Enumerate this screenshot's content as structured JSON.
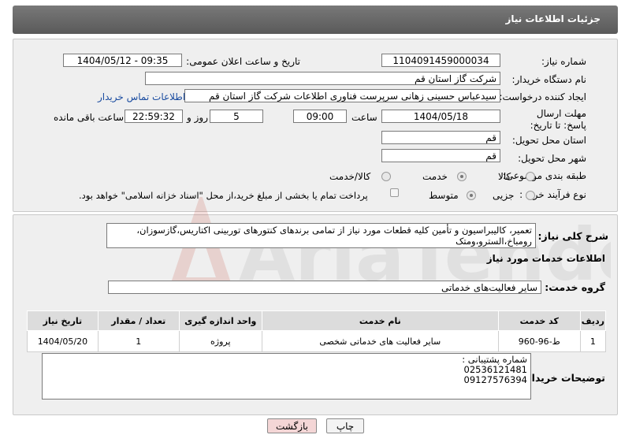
{
  "header": {
    "title": "جزئیات اطلاعات نیاز"
  },
  "labels": {
    "need_number": "شماره نیاز:",
    "announce_datetime": "تاریخ و ساعت اعلان عمومی:",
    "buyer_org": "نام دستگاه خریدار:",
    "requester": "ایجاد کننده درخواست:",
    "contact_link": "اطلاعات تماس خریدار",
    "deadline": "مهلت ارسال پاسخ: تا تاریخ:",
    "time_word": "ساعت",
    "day_and": "روز و",
    "remaining_time": "ساعت باقی مانده",
    "delivery_province": "استان محل تحویل:",
    "delivery_city": "شهر محل تحویل:",
    "category": "طبقه بندی موضوعی:",
    "purchase_type": "نوع فرآیند خرید :",
    "payment_note": "پرداخت تمام یا بخشی از مبلغ خرید،از محل \"اسناد خزانه اسلامی\" خواهد بود.",
    "description": "شرح کلی نیاز:",
    "services_info": "اطلاعات خدمات مورد نیاز",
    "service_group": "گروه خدمت:",
    "buyer_notes": "توضیحات خریدار:"
  },
  "values": {
    "need_number": "1104091459000034",
    "announce_datetime": "1404/05/12 - 09:35",
    "buyer_org": "شرکت گاز استان قم",
    "requester": "سیدعباس حسینی زهانی سرپرست فناوری اطلاعات شرکت گاز استان قم",
    "deadline_date": "1404/05/18",
    "deadline_time": "09:00",
    "days": "5",
    "remaining": "22:59:32",
    "delivery_province": "قم",
    "delivery_city": "قم",
    "description": "تعمیر، کالیبراسیون و تأمین کلیه قطعات  مورد نیاز از تمامی برندهای  کنتورهای توربینی اکتاریس،گازسوزان، رومباخ،السترو،ومتک",
    "service_group": "سایر فعالیت‌های خدماتی",
    "buyer_notes_line1": "شماره پشتیبانی :",
    "buyer_notes_line2": "02536121481",
    "buyer_notes_line3": "09127576394"
  },
  "category_options": [
    {
      "label": "کالا",
      "selected": false
    },
    {
      "label": "خدمت",
      "selected": true
    },
    {
      "label": "کالا/خدمت",
      "selected": false
    }
  ],
  "purchase_options": [
    {
      "label": "جزیی",
      "selected": false
    },
    {
      "label": "متوسط",
      "selected": true
    }
  ],
  "table": {
    "headers": [
      "ردیف",
      "کد خدمت",
      "نام خدمت",
      "واحد اندازه گیری",
      "تعداد / مقدار",
      "تاریخ نیاز"
    ],
    "rows": [
      [
        "1",
        "ط-96-960",
        "سایر فعالیت های خدماتی شخصی",
        "پروژه",
        "1",
        "1404/05/20"
      ]
    ]
  },
  "buttons": {
    "print": "چاپ",
    "back": "بازگشت"
  },
  "watermark": {
    "text": "AriaTender.net"
  },
  "colors": {
    "header_bg": "#666666",
    "panel_bg": "#efefef",
    "back_button_bg": "#f4d6d6",
    "link": "#1a4ca0"
  }
}
